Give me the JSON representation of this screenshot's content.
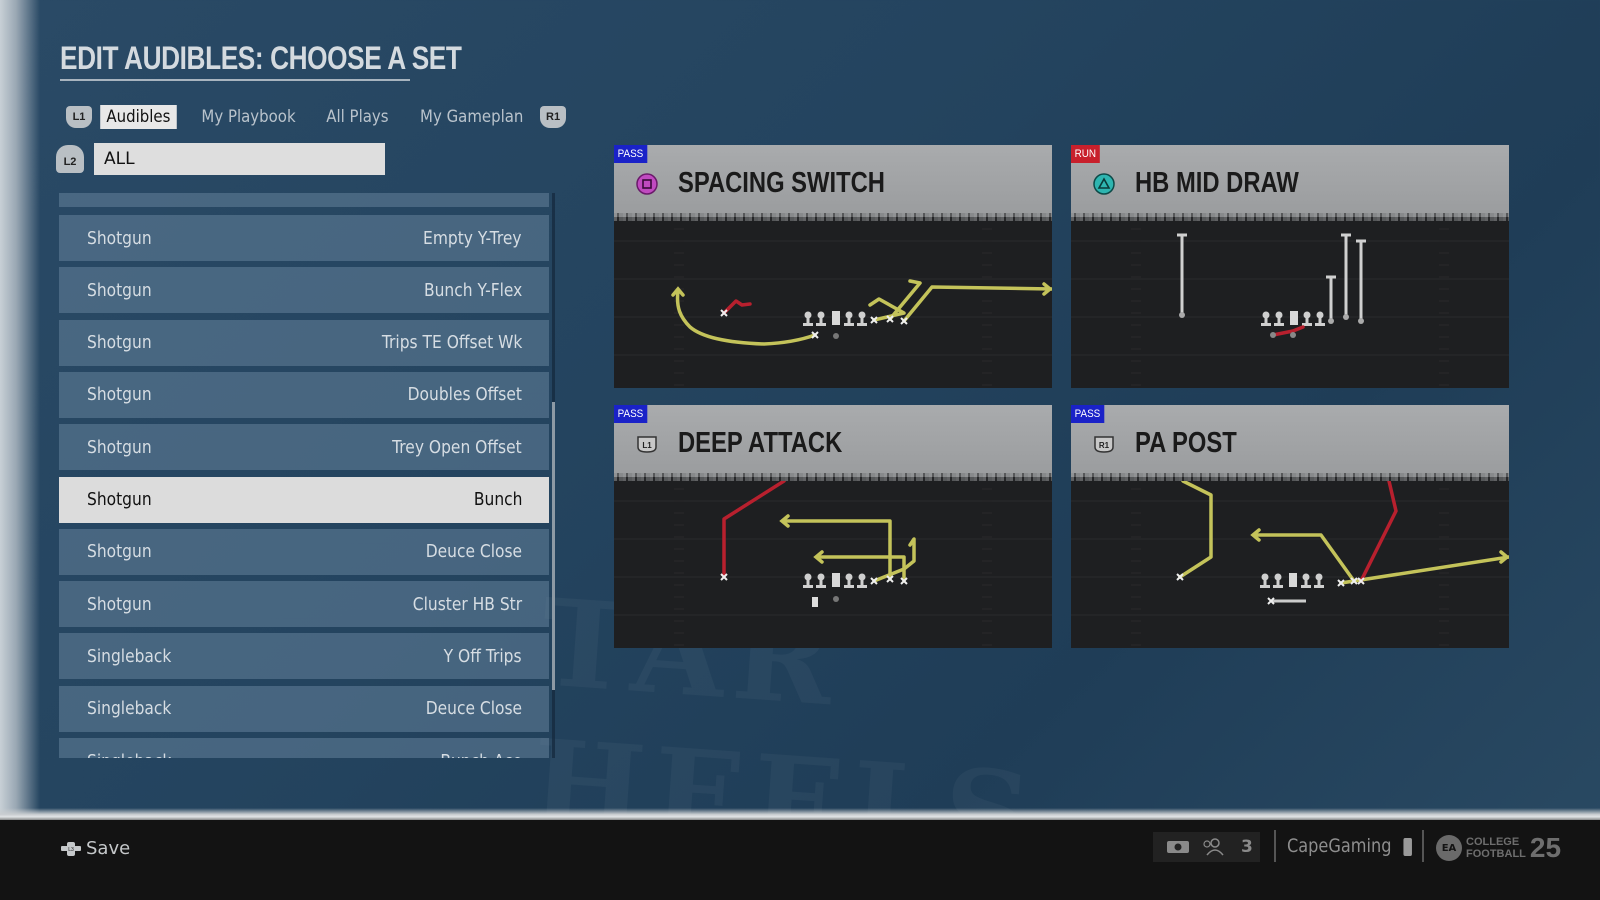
{
  "header": {
    "title": "EDIT AUDIBLES: CHOOSE A SET"
  },
  "tabs": {
    "left_bumper": "L1",
    "right_bumper": "R1",
    "items": [
      {
        "label": "Audibles",
        "active": true
      },
      {
        "label": "My Playbook",
        "active": false
      },
      {
        "label": "All Plays",
        "active": false
      },
      {
        "label": "My Gameplan",
        "active": false
      }
    ]
  },
  "filter": {
    "trigger": "L2",
    "value": "ALL"
  },
  "list": {
    "scroll_position_fraction": 0.37,
    "scroll_visible_fraction": 0.51,
    "items": [
      {
        "formation": "Shotgun",
        "set": "Empty Y-Trey",
        "selected": false
      },
      {
        "formation": "Shotgun",
        "set": "Bunch Y-Flex",
        "selected": false
      },
      {
        "formation": "Shotgun",
        "set": "Trips TE Offset Wk",
        "selected": false
      },
      {
        "formation": "Shotgun",
        "set": "Doubles Offset",
        "selected": false
      },
      {
        "formation": "Shotgun",
        "set": "Trey Open Offset",
        "selected": false
      },
      {
        "formation": "Shotgun",
        "set": "Bunch",
        "selected": true
      },
      {
        "formation": "Shotgun",
        "set": "Deuce Close",
        "selected": false
      },
      {
        "formation": "Shotgun",
        "set": "Cluster HB Str",
        "selected": false
      },
      {
        "formation": "Singleback",
        "set": "Y Off Trips",
        "selected": false
      },
      {
        "formation": "Singleback",
        "set": "Deuce Close",
        "selected": false
      },
      {
        "formation": "Singleback",
        "set": "Bunch Ace",
        "selected": false
      }
    ]
  },
  "plays": [
    {
      "type": "PASS",
      "type_color": "#1a22c8",
      "button": "square-icon",
      "button_label": "",
      "name": "SPACING SWITCH"
    },
    {
      "type": "RUN",
      "type_color": "#c8202c",
      "button": "triangle-icon",
      "button_label": "",
      "name": "HB MID DRAW"
    },
    {
      "type": "PASS",
      "type_color": "#1a22c8",
      "button": "l1-icon",
      "button_label": "L1",
      "name": "DEEP ATTACK"
    },
    {
      "type": "PASS",
      "type_color": "#1a22c8",
      "button": "r1-icon",
      "button_label": "R1",
      "name": "PA POST"
    }
  ],
  "footer": {
    "save_label": "Save",
    "party_count": "3",
    "gamertag": "CapeGaming",
    "logo_line1": "COLLEGE",
    "logo_line2": "FOOTBALL",
    "logo_number": "25",
    "logo_ea": "EA"
  },
  "colors": {
    "route_primary": "#c4c35a",
    "route_hot": "#b8202e",
    "pass_tag": "#1a22c8",
    "run_tag": "#c8202c"
  }
}
